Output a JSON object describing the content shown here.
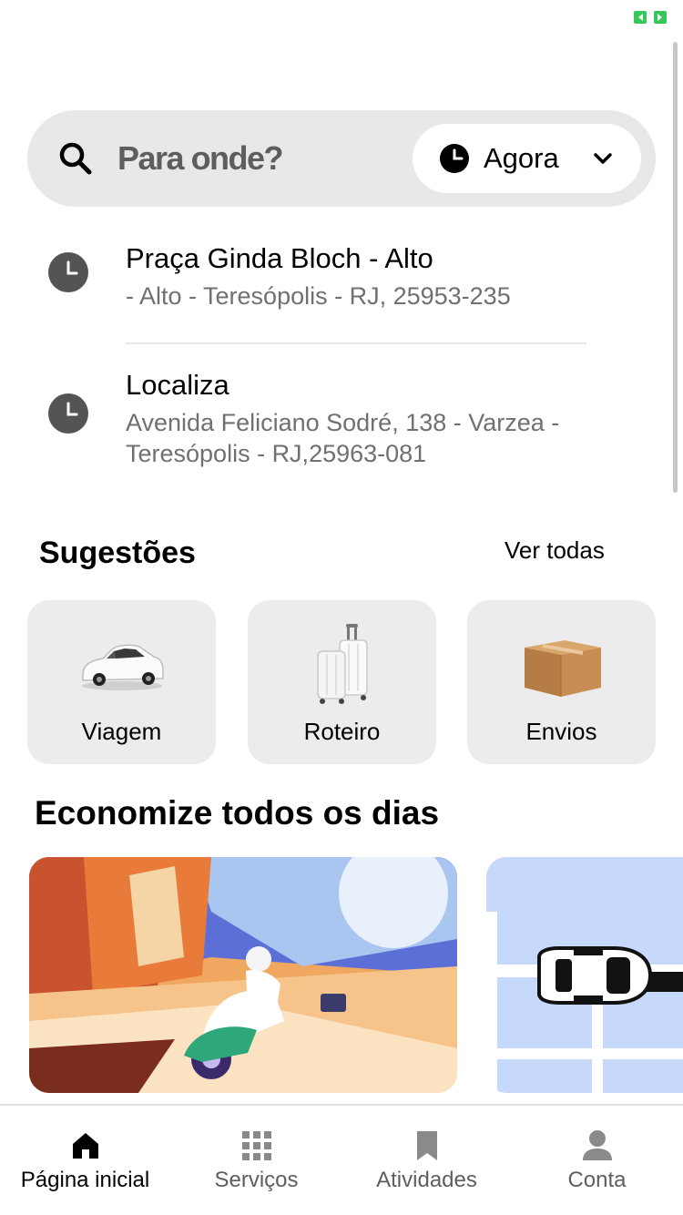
{
  "search": {
    "placeholder": "Para onde?",
    "time_label": "Agora",
    "icons": {
      "search": "search-icon",
      "clock": "clock-icon",
      "chevron": "chevron-down-icon"
    }
  },
  "recent": [
    {
      "title": "Praça Ginda Bloch - Alto",
      "subtitle": "- Alto - Teresópolis - RJ, 25953-235",
      "icon": "clock-icon"
    },
    {
      "title": "Localiza",
      "subtitle": "Avenida Feliciano Sodré, 138 - Varzea - Teresópolis - RJ,25963-081",
      "icon": "clock-icon"
    }
  ],
  "suggestions": {
    "title": "Sugestões",
    "see_all": "Ver todas",
    "items": [
      {
        "label": "Viagem",
        "icon": "car-icon"
      },
      {
        "label": "Roteiro",
        "icon": "luggage-icon"
      },
      {
        "label": "Envios",
        "icon": "package-icon"
      }
    ]
  },
  "savings": {
    "title": "Economize todos os dias",
    "cards": [
      {
        "image": "scooter-rider-illustration"
      },
      {
        "image": "car-on-map-illustration"
      }
    ]
  },
  "nav": {
    "items": [
      {
        "label": "Página inicial",
        "icon": "home-icon",
        "active": true
      },
      {
        "label": "Serviços",
        "icon": "grid-icon",
        "active": false
      },
      {
        "label": "Atividades",
        "icon": "bookmark-icon",
        "active": false
      },
      {
        "label": "Conta",
        "icon": "person-icon",
        "active": false
      }
    ]
  },
  "colors": {
    "accent_green": "#34c759",
    "surface_gray": "#e8e8e8",
    "text_secondary": "#707070"
  }
}
